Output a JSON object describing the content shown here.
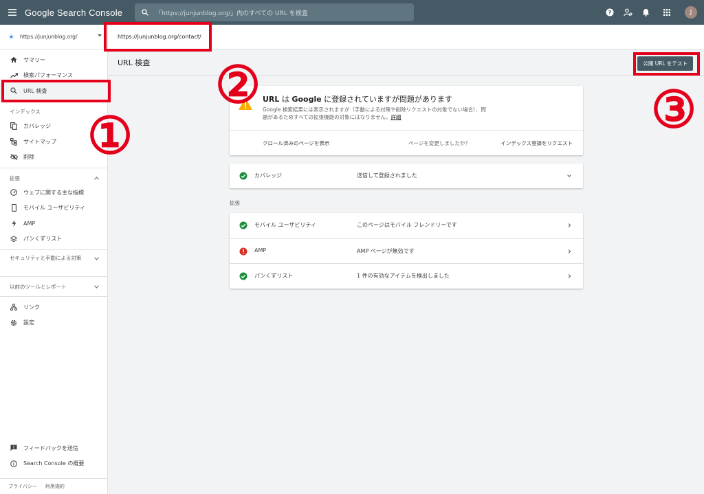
{
  "app": {
    "logo_text": "Google Search Console"
  },
  "search": {
    "placeholder": "「https://junjunblog.org/」内のすべての URL を検査"
  },
  "topbar": {
    "avatar_initial": "J"
  },
  "property": {
    "label": "https://junjunblog.org/"
  },
  "sidebar": {
    "items_top": [
      {
        "label": "サマリー",
        "icon": "home-icon"
      },
      {
        "label": "検索パフォーマンス",
        "icon": "trending-icon"
      },
      {
        "label": "URL 検査",
        "icon": "search-icon"
      }
    ],
    "index_section": "インデックス",
    "index_items": [
      {
        "label": "カバレッジ",
        "icon": "copy-icon"
      },
      {
        "label": "サイトマップ",
        "icon": "sitemap-icon"
      },
      {
        "label": "削除",
        "icon": "eye-off-icon"
      }
    ],
    "enhance_section": "拡張",
    "enhance_items": [
      {
        "label": "ウェブに関する主な指標",
        "icon": "gauge-icon"
      },
      {
        "label": "モバイル ユーザビリティ",
        "icon": "phone-icon"
      },
      {
        "label": "AMP",
        "icon": "bolt-icon"
      },
      {
        "label": "パンくずリスト",
        "icon": "layers-icon"
      }
    ],
    "security_section": "セキュリティと手動による対策",
    "legacy_section": "以前のツールとレポート",
    "links_label": "リンク",
    "settings_label": "設定",
    "feedback_label": "フィードバックを送信",
    "about_label": "Search Console の概要",
    "privacy": "プライバシー",
    "terms": "利用規約"
  },
  "inspected_url": "https://junjunblog.org/contact/",
  "page": {
    "title": "URL 検査",
    "test_button": "公開 URL をテスト"
  },
  "status": {
    "title_pre": "URL",
    "title_mid1": " は ",
    "title_brand": "Google",
    "title_post": " に登録されていますが問題があります",
    "desc": "Google 検索結果には表示されますが（手動による対策や削除リクエストの対象でない場合）、問題があるためすべての拡張機能の対象にはなりません。",
    "desc_link": "詳細",
    "action_left": "クロール済みのページを表示",
    "action_question": "ページを変更しましたか？",
    "action_right": "インデックス登録をリクエスト"
  },
  "coverage": {
    "name": "カバレッジ",
    "value": "送信して登録されました",
    "status": "ok"
  },
  "enhancements_label": "拡張",
  "enhancements": [
    {
      "name": "モバイル ユーザビリティ",
      "value": "このページはモバイル フレンドリーです",
      "status": "ok"
    },
    {
      "name": "AMP",
      "value": "AMP ページが無効です",
      "status": "error"
    },
    {
      "name": "パンくずリスト",
      "value": "1 件の有効なアイテムを検出しました",
      "status": "ok"
    }
  ],
  "annotations": {
    "one": "①",
    "two": "②",
    "three": "③"
  },
  "colors": {
    "topbar": "#455a64",
    "ok": "#1e8e3e",
    "error": "#d93025",
    "warn": "#f9ab00",
    "annotation": "#e4001b"
  }
}
